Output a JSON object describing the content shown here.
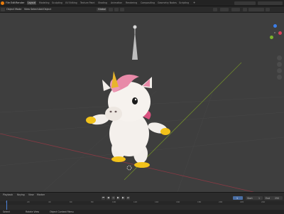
{
  "menubar": {
    "menus": [
      "File",
      "Edit",
      "Render",
      "Window",
      "Help"
    ],
    "workspaces": [
      "Layout",
      "Modeling",
      "Sculpting",
      "UV Editing",
      "Texture Paint",
      "Shading",
      "Animation",
      "Rendering",
      "Compositing",
      "Geometry Nodes",
      "Scripting"
    ],
    "active_workspace": "Layout"
  },
  "header": {
    "mode": "Object Mode",
    "view": "View",
    "select": "Select",
    "add": "Add",
    "object": "Object",
    "transform": "Global"
  },
  "viewport": {
    "model": "unicorn-character",
    "colors": {
      "background": "#3e3e3e",
      "grid": "#474747",
      "x_axis": "#8a3a44",
      "y_axis": "#6f8a2c",
      "body": "#f2eeea",
      "mane": "#e88aa8",
      "horn": "#e8b52c",
      "hooves": "#f2c21a"
    }
  },
  "timeline": {
    "playback": "Playback",
    "keying": "Keying",
    "view": "View",
    "marker": "Marker",
    "current_frame": "1",
    "start_label": "Start",
    "start": "1",
    "end_label": "End",
    "end": "250",
    "ticks": [
      "0",
      "20",
      "40",
      "60",
      "80",
      "100",
      "120",
      "140",
      "160",
      "180",
      "200",
      "220",
      "240"
    ]
  },
  "statusbar": {
    "select": "Select",
    "rotate": "Rotate View",
    "context": "Object Context Menu"
  }
}
